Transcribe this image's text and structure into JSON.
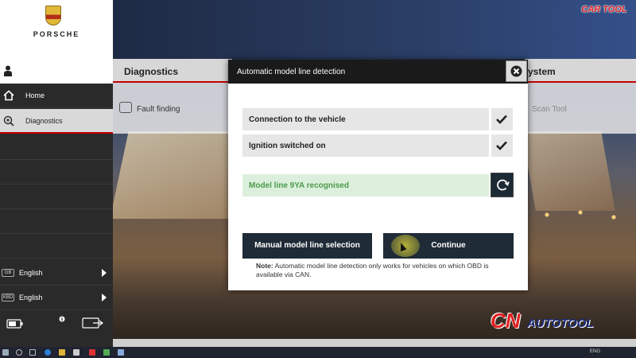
{
  "header": {
    "brand": "PORSCHE",
    "watermark_top": "CAR TOOL"
  },
  "sidebar": {
    "items": [
      {
        "label": "Home",
        "icon": "home-icon"
      },
      {
        "label": "Diagnostics",
        "icon": "diagnostics-icon",
        "active": true
      }
    ],
    "languages": [
      {
        "badge": "GB",
        "label": "English"
      },
      {
        "badge": "KBD",
        "label": "English"
      }
    ]
  },
  "main": {
    "tab_diagnostics": "Diagnostics",
    "tab_system": "ystem",
    "fault_finding": "Fault finding",
    "scan_tool": "Scan Tool"
  },
  "modal": {
    "title": "Automatic model line detection",
    "checks": [
      {
        "label": "Connection to the vehicle",
        "status": "done"
      },
      {
        "label": "Ignition switched on",
        "status": "done"
      }
    ],
    "model_line": "Model line 9YA recognised",
    "btn_manual": "Manual model line selection",
    "btn_continue": "Continue",
    "note_label": "Note:",
    "note_text": "Automatic model line detection only works for vehicles on which OBD is available via CAN."
  },
  "watermark": {
    "cn": "CN",
    "autotool": "AUTOTOOL"
  },
  "taskbar": {
    "lang": "ENG"
  },
  "colors": {
    "accent_red": "#c40000",
    "button_dark": "#1f2b36",
    "success_green": "#4a9a4a"
  }
}
